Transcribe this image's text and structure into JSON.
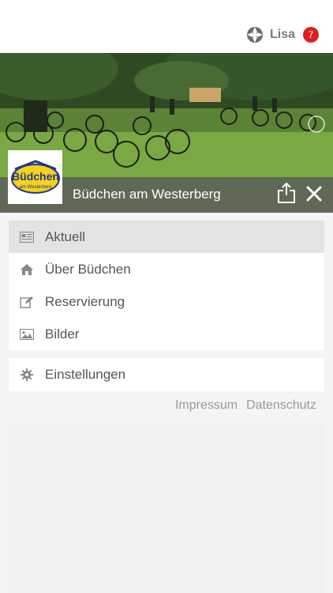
{
  "header": {
    "user_name": "Lisa",
    "notification_count": "7",
    "user_icon": "steering-wheel-icon"
  },
  "venue": {
    "name": "Büdchen am Westerberg",
    "logo_text_main": "Büdchen",
    "logo_text_sub": "am Westerberg"
  },
  "menu": {
    "items": [
      {
        "label": "Aktuell",
        "icon": "newspaper-icon",
        "active": true
      },
      {
        "label": "Über Büdchen",
        "icon": "home-icon",
        "active": false
      },
      {
        "label": "Reservierung",
        "icon": "edit-icon",
        "active": false
      },
      {
        "label": "Bilder",
        "icon": "image-icon",
        "active": false
      }
    ],
    "settings": {
      "label": "Einstellungen",
      "icon": "gear-icon"
    }
  },
  "footer": {
    "impressum": "Impressum",
    "datenschutz": "Datenschutz"
  },
  "colors": {
    "badge": "#e01e1e",
    "menu_text": "#555555",
    "active_bg": "#e3e3e3"
  }
}
